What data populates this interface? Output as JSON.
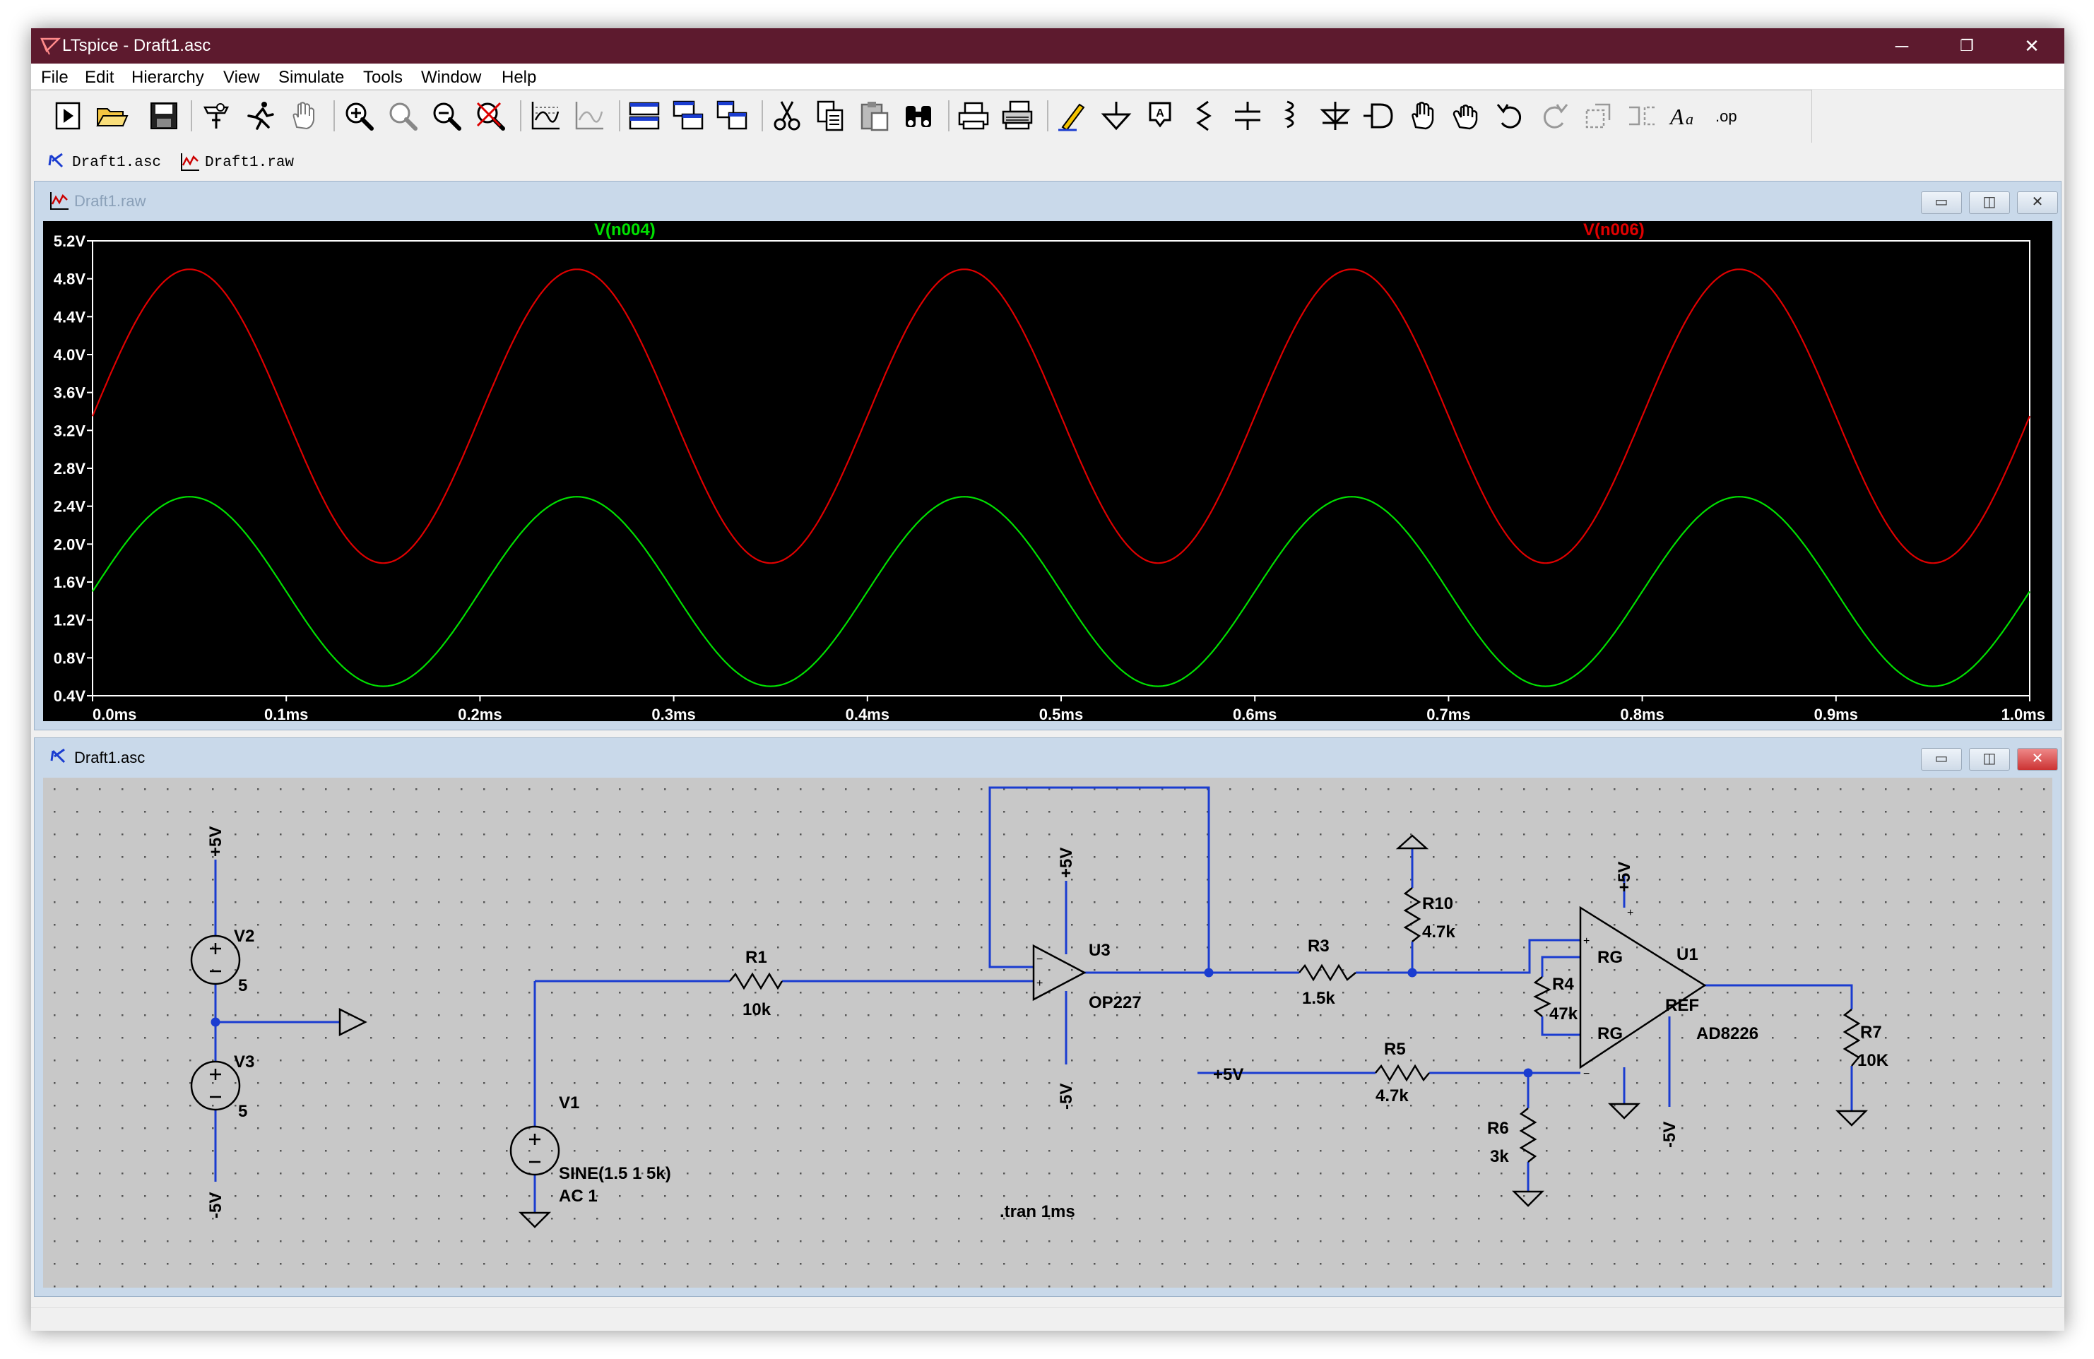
{
  "window": {
    "title": "LTspice - Draft1.asc",
    "minimize": "─",
    "maximize": "❐",
    "close": "✕"
  },
  "menu": [
    "File",
    "Edit",
    "Hierarchy",
    "View",
    "Simulate",
    "Tools",
    "Window",
    "Help"
  ],
  "toolbar_icons": [
    "run-icon",
    "open-icon",
    "save-icon",
    "control-panel-icon",
    "run-simulation-icon",
    "pan-icon",
    "zoom-in-icon",
    "zoom-full-icon",
    "zoom-out-icon",
    "zoom-cancel-icon",
    "autorange-icon",
    "delete-traces-icon",
    "tile-horizontal-icon",
    "cascade-icon",
    "tile-vertical-icon",
    "cut-icon",
    "copy-icon",
    "paste-icon",
    "find-icon",
    "print-icon",
    "print-setup-icon",
    "draw-wire-icon",
    "ground-icon",
    "label-net-icon",
    "resistor-icon",
    "capacitor-icon",
    "inductor-icon",
    "diode-icon",
    "component-icon",
    "move-icon",
    "drag-icon",
    "undo-icon",
    "redo-icon",
    "rotate-icon",
    "mirror-icon",
    "text-icon",
    "spice-directive-icon"
  ],
  "tabs": [
    {
      "label": "Draft1.asc"
    },
    {
      "label": "Draft1.raw"
    }
  ],
  "waveform_window": {
    "title": "Draft1.raw",
    "btn_min": "▭",
    "btn_restore": "◫",
    "btn_close": "✕"
  },
  "schematic_window": {
    "title": "Draft1.asc",
    "btn_min": "▭",
    "btn_restore": "◫",
    "btn_close": "✕"
  },
  "chart_data": {
    "type": "line",
    "x_ticks": [
      "0.0ms",
      "0.1ms",
      "0.2ms",
      "0.3ms",
      "0.4ms",
      "0.5ms",
      "0.6ms",
      "0.7ms",
      "0.8ms",
      "0.9ms",
      "1.0ms"
    ],
    "y_ticks": [
      "5.2V",
      "4.8V",
      "4.4V",
      "4.0V",
      "3.6V",
      "3.2V",
      "2.8V",
      "2.4V",
      "2.0V",
      "1.6V",
      "1.2V",
      "0.8V",
      "0.4V"
    ],
    "xlim": [
      0,
      1.0
    ],
    "ylim": [
      0.4,
      5.2
    ],
    "grid": false,
    "series": [
      {
        "name": "V(n004)",
        "color": "#00e000",
        "offset": 1.5,
        "amplitude": 1.0,
        "frequency_khz": 5
      },
      {
        "name": "V(n006)",
        "color": "#e00000",
        "offset": 3.35,
        "amplitude": 1.55,
        "frequency_khz": 5
      }
    ]
  },
  "schematic": {
    "labels": {
      "v2_top": "+5V",
      "v2_name": "V2",
      "v2_val": "5",
      "v3_name": "V3",
      "v3_val": "5",
      "v3_bot": "-5V",
      "v1_name": "V1",
      "v1_val1": "SINE(1.5 1 5k)",
      "v1_val2": "AC 1",
      "r1_name": "R1",
      "r1_val": "10k",
      "u3_top": "+5V",
      "u3_name": "U3",
      "u3_model": "OP227",
      "u3_bot": "-5V",
      "r3_name": "R3",
      "r3_val": "1.5k",
      "r10_name": "R10",
      "r10_val": "4.7k",
      "r4_name": "R4",
      "r4_val": "47k",
      "r5_name": "R5",
      "r5_val": "4.7k",
      "plus5_label": "+5V",
      "r6_name": "R6",
      "r6_val": "3k",
      "u1_top": "+5V",
      "u1_name": "U1",
      "u1_model": "AD8226",
      "u1_bot": "-5V",
      "u1_rg1": "RG",
      "u1_rg2": "RG",
      "u1_ref": "REF",
      "r7_name": "R7",
      "r7_val": "10K",
      "directive": ".tran 1ms"
    }
  }
}
